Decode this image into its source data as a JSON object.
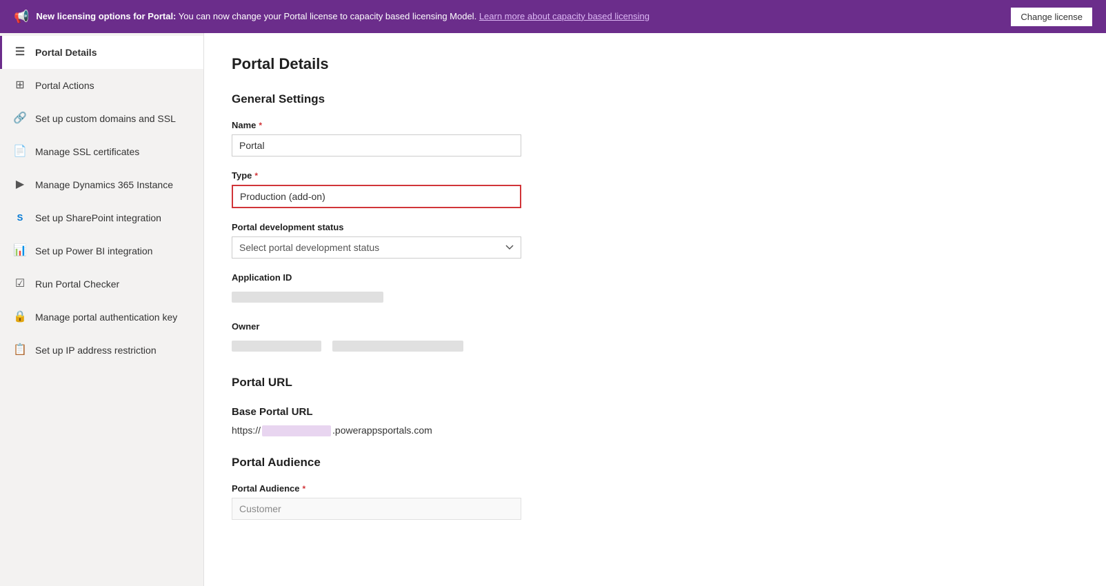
{
  "banner": {
    "icon": "📢",
    "text_bold": "New licensing options for Portal:",
    "text": " You can now change your Portal license to capacity based licensing Model.",
    "link": "Learn more about capacity based licensing",
    "button": "Change license"
  },
  "sidebar": {
    "items": [
      {
        "id": "portal-details",
        "label": "Portal Details",
        "icon": "☰",
        "active": true
      },
      {
        "id": "portal-actions",
        "label": "Portal Actions",
        "icon": "⊞"
      },
      {
        "id": "custom-domains",
        "label": "Set up custom domains and SSL",
        "icon": "🔗"
      },
      {
        "id": "ssl-certs",
        "label": "Manage SSL certificates",
        "icon": "📄"
      },
      {
        "id": "dynamics-instance",
        "label": "Manage Dynamics 365 Instance",
        "icon": "▶"
      },
      {
        "id": "sharepoint",
        "label": "Set up SharePoint integration",
        "icon": "S"
      },
      {
        "id": "powerbi",
        "label": "Set up Power BI integration",
        "icon": "📊"
      },
      {
        "id": "portal-checker",
        "label": "Run Portal Checker",
        "icon": "☑"
      },
      {
        "id": "auth-key",
        "label": "Manage portal authentication key",
        "icon": "🔒"
      },
      {
        "id": "ip-restriction",
        "label": "Set up IP address restriction",
        "icon": "📋"
      }
    ]
  },
  "content": {
    "page_title": "Portal Details",
    "general_settings": {
      "section_title": "General Settings",
      "name_label": "Name",
      "name_required": "*",
      "name_value": "Portal",
      "type_label": "Type",
      "type_required": "*",
      "type_value": "Production (add-on)",
      "portal_dev_status_label": "Portal development status",
      "portal_dev_status_placeholder": "Select portal development status",
      "application_id_label": "Application ID",
      "owner_label": "Owner"
    },
    "portal_url": {
      "section_title": "Portal URL",
      "base_url_label": "Base Portal URL",
      "base_url_prefix": "https://",
      "base_url_suffix": ".powerappsportals.com"
    },
    "portal_audience": {
      "section_title": "Portal Audience",
      "audience_label": "Portal Audience",
      "audience_required": "*",
      "audience_value": "Customer"
    }
  }
}
